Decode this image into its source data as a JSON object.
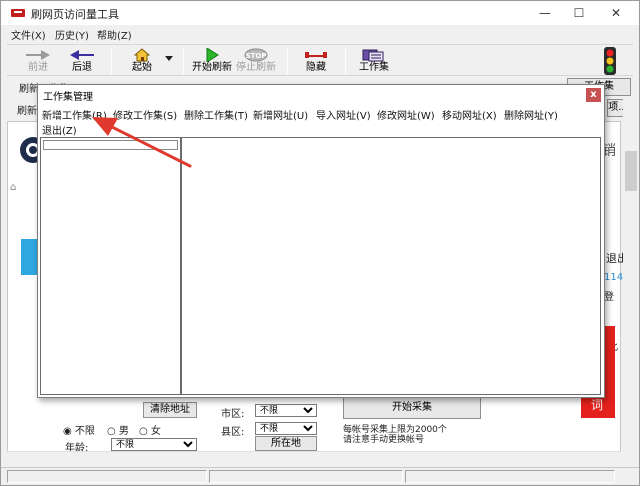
{
  "window": {
    "title": "刷网页访问量工具",
    "minimize": "—",
    "maximize": "☐",
    "close": "✕"
  },
  "menu": [
    "文件(X)",
    "历史(Y)",
    "帮助(Z)"
  ],
  "toolbar": {
    "forward": "前进",
    "back": "后退",
    "start": "起始",
    "start_refresh": "开始刷新",
    "stop_refresh": "停止刷新",
    "stop_badge": "STOP",
    "hide": "隐藏",
    "workset": "工作集"
  },
  "background": {
    "refresh_workset": "刷新工作集",
    "refresh_label_2": "刷新",
    "workset_btn": "工作集",
    "options_btn": "项...",
    "sell": "销",
    "clear_address": "清除地址",
    "gender_unlimited": "不限",
    "gender_male": "男",
    "gender_female": "女",
    "age_label": "年龄:",
    "age_value": "不限",
    "city_label": "市区:",
    "city_value": "不限",
    "county_label": "县区:",
    "county_value": "不限",
    "location_btn": "所在地",
    "start_collect": "开始采集",
    "note1": "每帐号采集上限为2000个",
    "note2": "请注意手动更换帐号",
    "red_btn_char": "词",
    "right_text_1": "退出",
    "right_text_2": "114",
    "right_text_3": "登",
    "right_text_4": "此"
  },
  "dialog": {
    "title": "工作集管理",
    "close": "x",
    "menu": [
      "新增工作集(R)",
      "修改工作集(S)",
      "删除工作集(T)",
      "新增网址(U)",
      "导入网址(V)",
      "修改网址(W)",
      "移动网址(X)",
      "删除网址(Y)",
      "退出(Z)"
    ]
  },
  "colors": {
    "accent_red": "#e03a2f",
    "close_red": "#c75050",
    "toolbar_bg": "#f0f0f0"
  }
}
